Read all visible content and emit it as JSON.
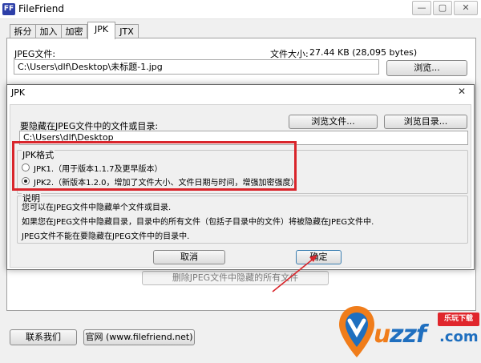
{
  "app": {
    "title": "FileFriend",
    "icon_text": "FF"
  },
  "window_controls": {
    "minimize": "—",
    "maximize": "▢",
    "close": "✕"
  },
  "tabs": [
    {
      "label": "拆分",
      "active": false
    },
    {
      "label": "加入",
      "active": false
    },
    {
      "label": "加密",
      "active": false
    },
    {
      "label": "JPK",
      "active": true
    },
    {
      "label": "JTX",
      "active": false
    }
  ],
  "jpeg": {
    "label": "JPEG文件:",
    "size_label": "文件大小:",
    "size_value": "27.44 KB (28,095 bytes)",
    "path": "C:\\Users\\dlf\\Desktop\\未标题-1.jpg",
    "browse_label": "浏览..."
  },
  "remove_hidden_label": "删除JPEG文件中隐藏的所有文件",
  "footer": {
    "contact_label": "联系我们",
    "website_label": "官网 (www.filefriend.net)"
  },
  "dialog": {
    "title": "JPK",
    "close": "✕",
    "hide_label": "要隐藏在JPEG文件中的文件或目录:",
    "browse_file_label": "浏览文件...",
    "browse_dir_label": "浏览目录...",
    "path": "C:\\Users\\dlf\\Desktop",
    "format_group_label": "JPK格式",
    "options": [
      {
        "label": "JPK1.（用于版本1.1.7及更早版本）",
        "checked": false
      },
      {
        "label": "JPK2.（新版本1.2.0，增加了文件大小、文件日期与时间，增强加密强度）",
        "checked": true
      }
    ],
    "desc_group_label": "说明",
    "desc_lines": [
      "您可以在JPEG文件中隐藏单个文件或目录.",
      "如果您在JPEG文件中隐藏目录，目录中的所有文件（包括子目录中的文件）将被隐藏在JPEG文件中.",
      "JPEG文件不能在要隐藏在JPEG文件中的目录中."
    ],
    "cancel_label": "取消",
    "ok_label": "确定"
  },
  "colors": {
    "highlight": "#d9252b",
    "watermark_orange": "#f07d1b",
    "watermark_blue": "#1f6fbf"
  },
  "watermark": {
    "letter_u": "u",
    "letters_zzf": "zzf",
    "domain": ".com",
    "badge": "乐玩下载"
  }
}
